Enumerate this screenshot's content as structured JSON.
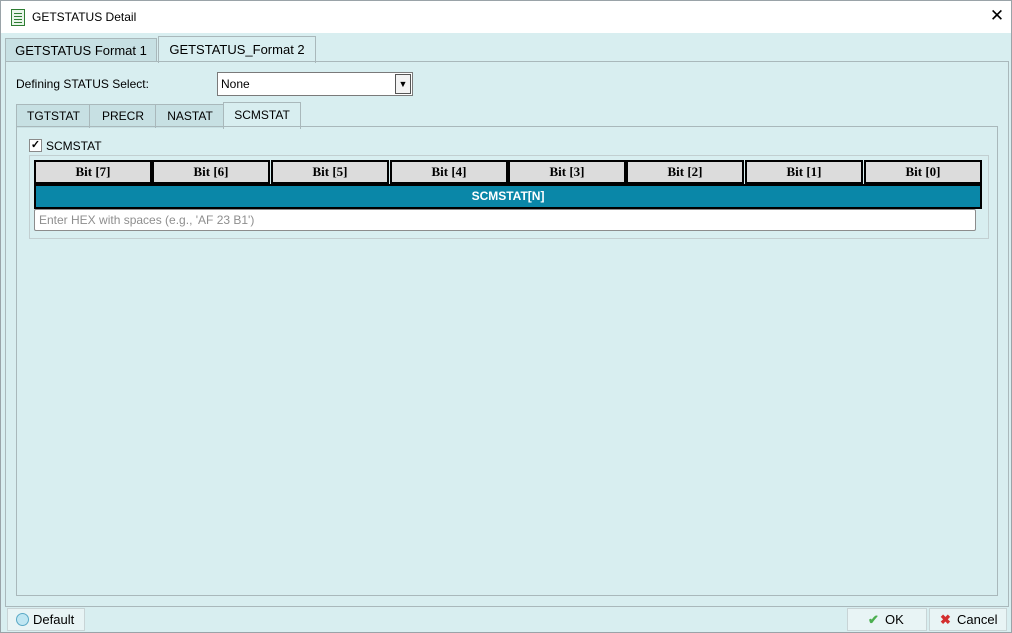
{
  "window": {
    "title": "GETSTATUS Detail"
  },
  "outer_tabs": [
    {
      "label": "GETSTATUS Format 1",
      "active": false
    },
    {
      "label": "GETSTATUS_Format 2",
      "active": true
    }
  ],
  "defining_status": {
    "label": "Defining STATUS Select:",
    "value": "None"
  },
  "inner_tabs": [
    {
      "label": "TGTSTAT",
      "active": false
    },
    {
      "label": "PRECR",
      "active": false
    },
    {
      "label": "NASTAT",
      "active": false
    },
    {
      "label": "SCMSTAT",
      "active": true
    }
  ],
  "scmstat": {
    "checkbox_label": "SCMSTAT",
    "checked": true,
    "check_mark": "✓",
    "bits": [
      "Bit [7]",
      "Bit [6]",
      "Bit [5]",
      "Bit [4]",
      "Bit [3]",
      "Bit [2]",
      "Bit [1]",
      "Bit [0]"
    ],
    "field_label": "SCMSTAT[N]",
    "hex_placeholder": "Enter HEX with spaces (e.g., 'AF 23 B1')",
    "field_color": "#0a87a8"
  },
  "footer": {
    "default_label": "Default",
    "ok_label": "OK",
    "cancel_label": "Cancel"
  },
  "icons": {
    "app": "document-list-icon",
    "close": "close-icon",
    "dropdown": "chevron-down-icon",
    "ok": "checkmark-icon",
    "cancel": "x-mark-icon"
  }
}
